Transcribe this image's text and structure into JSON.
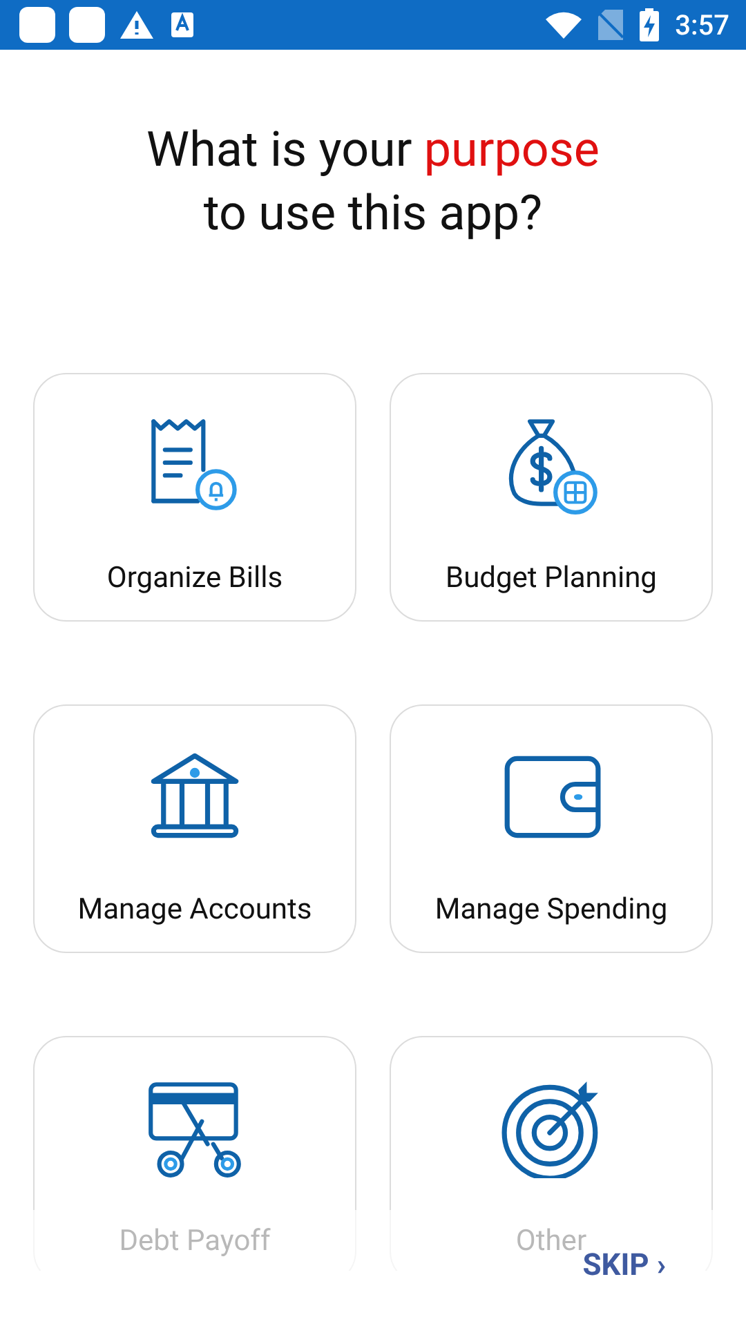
{
  "status_bar": {
    "time": "3:57"
  },
  "heading": {
    "before": "What is your",
    "highlight": "purpose",
    "after": "to use this app?"
  },
  "options": [
    {
      "label": "Organize Bills"
    },
    {
      "label": "Budget Planning"
    },
    {
      "label": "Manage Accounts"
    },
    {
      "label": "Manage Spending"
    },
    {
      "label": "Debt Payoff"
    },
    {
      "label": "Other"
    }
  ],
  "skip": {
    "label": "SKIP",
    "arrow": "›"
  }
}
